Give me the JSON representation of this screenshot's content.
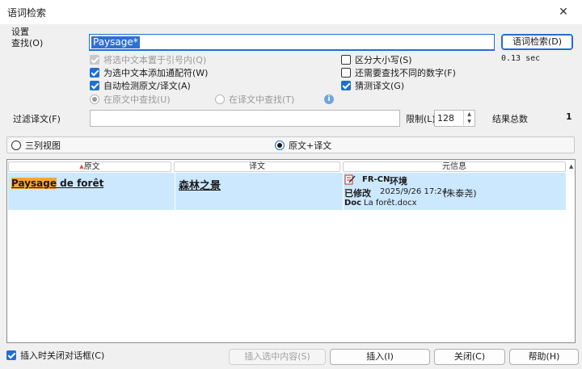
{
  "window": {
    "title": "语词检索",
    "close_glyph": "✕"
  },
  "settings": {
    "group_label": "设置"
  },
  "search": {
    "label": "查找(O)",
    "value": "Paysage*",
    "button": "语词检索(D)",
    "elapsed": "0.13 sec"
  },
  "options": {
    "quote_selection": {
      "label": "将选中文本置于引号内(Q)",
      "checked": true,
      "enabled": false
    },
    "add_wildcard": {
      "label": "为选中文本添加通配符(W)",
      "checked": true,
      "enabled": true
    },
    "auto_detect": {
      "label": "自动检测原文/译文(A)",
      "checked": true,
      "enabled": true
    },
    "case_sensitive": {
      "label": "区分大小写(S)",
      "checked": false,
      "enabled": true
    },
    "find_diff_numbers": {
      "label": "还需要查找不同的数字(F)",
      "checked": false,
      "enabled": true
    },
    "guess_translation": {
      "label": "猜测译文(G)",
      "checked": true,
      "enabled": true
    },
    "search_source": {
      "label": "在原文中查找(U)",
      "checked": true,
      "enabled": false
    },
    "search_target": {
      "label": "在译文中查找(T)",
      "checked": false,
      "enabled": false
    }
  },
  "filter": {
    "label": "过滤译文(F)",
    "value": ""
  },
  "limit": {
    "label": "限制(L)",
    "value": "128"
  },
  "results": {
    "label": "结果总数",
    "count": "1"
  },
  "view": {
    "three_column": {
      "label": "三列视图",
      "checked": false
    },
    "source_target": {
      "label": "原文+译文",
      "checked": true
    }
  },
  "grid": {
    "columns": [
      "原文",
      "译文",
      "元信息"
    ],
    "rows": [
      {
        "source_highlight": "Paysage",
        "source_rest": " de forêt",
        "target": "森林之景",
        "lang_pair": "FR-CN",
        "tm_name": "环境",
        "status": "已修改",
        "datetime": "2025/9/26 17:24",
        "user": "(朱泰尧)",
        "doc_label": "Doc",
        "doc_name": "La forêt.docx"
      }
    ]
  },
  "footer": {
    "close_on_insert": {
      "label": "插入时关闭对话框(C)",
      "checked": true
    },
    "insert_selected": "插入选中内容(S)",
    "insert": "插入(I)",
    "close": "关闭(C)",
    "help": "帮助(H)"
  }
}
